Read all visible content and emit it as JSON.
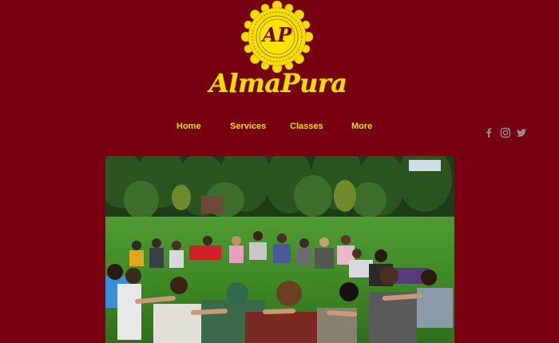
{
  "brand": {
    "monogram": "AP",
    "name": "AlmaPura"
  },
  "nav": {
    "items": [
      {
        "label": "Home"
      },
      {
        "label": "Services"
      },
      {
        "label": "Classes"
      },
      {
        "label": "More"
      }
    ]
  },
  "social": {
    "icons": [
      "facebook-icon",
      "instagram-icon",
      "twitter-icon"
    ]
  },
  "colors": {
    "background": "#7a0012",
    "header": "#76000f",
    "accent": "#f4de00",
    "social_icon": "#9a8a8c"
  },
  "hero": {
    "description": "photo"
  }
}
